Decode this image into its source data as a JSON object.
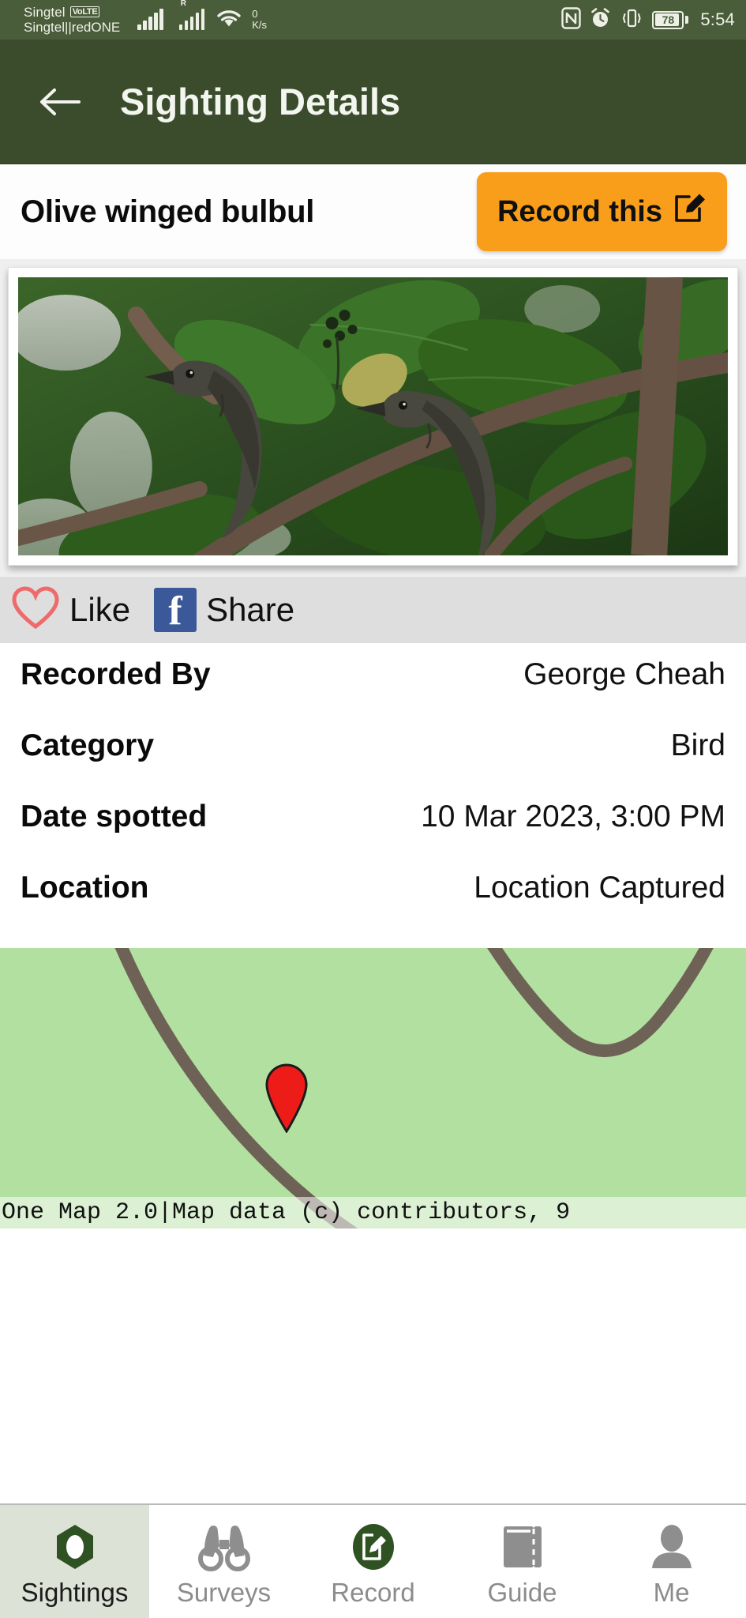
{
  "status_bar": {
    "carrier_primary": "Singtel",
    "volte_badge": "VoLTE",
    "carrier_secondary": "Singtel||redONE",
    "roaming_indicator": "R",
    "net_speed_value": "0",
    "net_speed_unit": "K/s",
    "battery_percent": "78",
    "time": "5:54",
    "icons": [
      "signal-bars-icon",
      "roaming-signal-bars-icon",
      "wifi-icon",
      "nfc-icon",
      "alarm-icon",
      "vibrate-icon",
      "battery-icon"
    ]
  },
  "app_bar": {
    "back_icon": "arrow-left-icon",
    "title": "Sighting Details"
  },
  "sighting": {
    "species_name": "Olive winged bulbul",
    "record_button_label": "Record this",
    "record_button_icon": "edit-square-icon",
    "photo_alt": "Two olive-winged bulbul birds perched on branches among green leaves"
  },
  "social": {
    "like_label": "Like",
    "like_icon": "heart-outline-icon",
    "share_label": "Share",
    "share_icon": "facebook-icon"
  },
  "details": [
    {
      "label": "Recorded By",
      "value": "George Cheah"
    },
    {
      "label": "Category",
      "value": "Bird"
    },
    {
      "label": "Date spotted",
      "value": "10 Mar 2023, 3:00 PM"
    },
    {
      "label": "Location",
      "value": "Location Captured"
    }
  ],
  "map": {
    "marker_icon": "map-pin-icon",
    "attribution": "One Map 2.0|Map data (c) contributors, 9"
  },
  "bottom_nav": [
    {
      "label": "Sightings",
      "icon": "eye-icon",
      "active": true
    },
    {
      "label": "Surveys",
      "icon": "binoculars-icon",
      "active": false
    },
    {
      "label": "Record",
      "icon": "record-edit-icon",
      "active": false
    },
    {
      "label": "Guide",
      "icon": "book-icon",
      "active": false
    },
    {
      "label": "Me",
      "icon": "person-icon",
      "active": false
    }
  ],
  "colors": {
    "status_bar_bg": "#4a5d3a",
    "app_bar_bg": "#3b4c2d",
    "accent_orange": "#f89e1b",
    "brand_green": "#2f5222",
    "facebook_blue": "#3b5998",
    "heart_red": "#ef6a6a",
    "map_land": "#b2e0a0",
    "map_road": "#6e6257",
    "marker_red": "#ee1c18"
  }
}
